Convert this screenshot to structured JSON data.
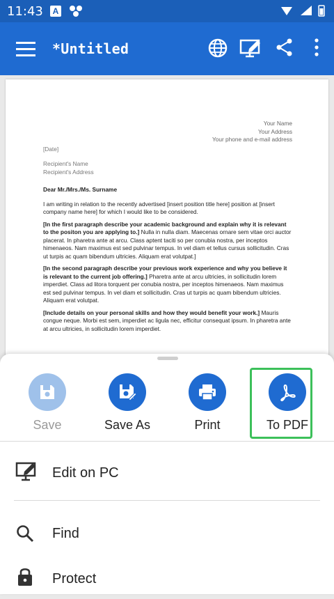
{
  "status": {
    "time": "11:43",
    "a_badge": "A"
  },
  "appbar": {
    "title": "*Untitled"
  },
  "document": {
    "sender_name": "Your Name",
    "sender_address": "Your Address",
    "sender_contact": "Your phone and e-mail address",
    "date": "[Date]",
    "recipient_name": "Recipient's Name",
    "recipient_address": "Recipient's Address",
    "salutation": "Dear Mr./Mrs./Ms. Surname",
    "para1": "I am writing in relation to the recently advertised [insert position title here] position at [insert company name here] for which I would like to be considered.",
    "para2_bold": "[In the first paragraph describe your academic background and explain why it is relevant to the positon you are applying to.]",
    "para2_rest": " Nulla in nulla diam. Maecenas ornare sem vitae orci auctor placerat. In pharetra ante at arcu. Class aptent taciti so per conubia nostra, per inceptos himenaeos. Nam maximus est sed pulvinar tempus. In vel diam et tellus cursus sollicitudin. Cras ut turpis ac quam bibendum ultricies. Aliquam erat volutpat.]",
    "para3_bold": "[In the second paragraph describe your previous work experience and why you believe it is relevant to the current job offering.]",
    "para3_rest": " Pharetra ante at arcu ultricies, in sollicitudin lorem imperdiet. Class ad litora torquent per conubia nostra, per inceptos himenaeos. Nam maximus est sed pulvinar tempus. In vel diam et sollicitudin. Cras ut turpis ac quam bibendum ultricies. Aliquam erat volutpat.",
    "para4_bold": "[Include details on your personal skills and how they would benefit your work.]",
    "para4_rest": " Mauris congue neque. Morbi est sem, imperdiet ac ligula nec, efficitur consequat ipsum. In pharetra ante at arcu ultricies, in sollicitudin lorem imperdiet."
  },
  "sheet": {
    "actions": [
      {
        "label": "Save"
      },
      {
        "label": "Save As"
      },
      {
        "label": "Print"
      },
      {
        "label": "To PDF"
      }
    ],
    "menu": [
      {
        "label": "Edit on PC"
      },
      {
        "label": "Find"
      },
      {
        "label": "Protect"
      }
    ]
  },
  "colors": {
    "appbar": "#1f6bd1",
    "statusbar": "#1b5fb8",
    "accent": "#1f6bd1",
    "disabled": "#9fc1ea",
    "highlight": "#3cc05a"
  }
}
